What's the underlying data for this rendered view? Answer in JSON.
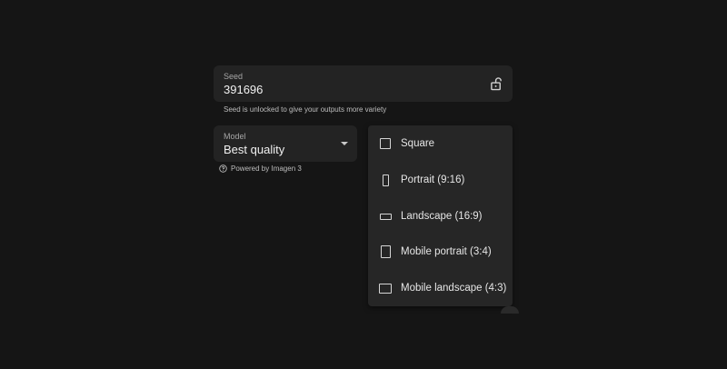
{
  "seed": {
    "label": "Seed",
    "value": "391696",
    "hint": "Seed is unlocked to give your outputs more variety"
  },
  "model": {
    "label": "Model",
    "value": "Best quality",
    "powered_by": "Powered by Imagen 3"
  },
  "aspect_menu": {
    "items": [
      {
        "label": "Square",
        "icon": "square-icon"
      },
      {
        "label": "Portrait (9:16)",
        "icon": "portrait-icon"
      },
      {
        "label": "Landscape (16:9)",
        "icon": "landscape-icon"
      },
      {
        "label": "Mobile portrait (3:4)",
        "icon": "mobile-portrait-icon"
      },
      {
        "label": "Mobile landscape (4:3)",
        "icon": "mobile-landscape-icon"
      }
    ]
  },
  "colors": {
    "background": "#151515",
    "field": "#232323",
    "menu": "#262626"
  }
}
